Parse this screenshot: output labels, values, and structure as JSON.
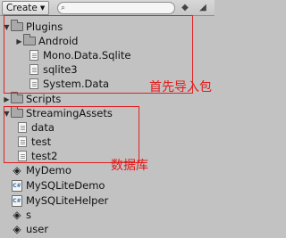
{
  "toolbar": {
    "create_label": "Create",
    "search_placeholder": ""
  },
  "tree": {
    "plugins": {
      "label": "Plugins",
      "android": "Android",
      "mono_data_sqlite": "Mono.Data.Sqlite",
      "sqlite3": "sqlite3",
      "system_data": "System.Data"
    },
    "scripts": "Scripts",
    "streaming_assets": {
      "label": "StreamingAssets",
      "data": "data",
      "test": "test",
      "test2": "test2"
    },
    "my_demo": "MyDemo",
    "my_sqlite_demo": "MySQLiteDemo",
    "my_sqlite_helper": "MySQLiteHelper",
    "s": "s",
    "user": "user"
  },
  "annotations": {
    "import_packages": "首先导入包",
    "database": "数据库"
  },
  "colors": {
    "panel_background": "#c2c2c2",
    "annotation_red": "#e21a1a"
  }
}
